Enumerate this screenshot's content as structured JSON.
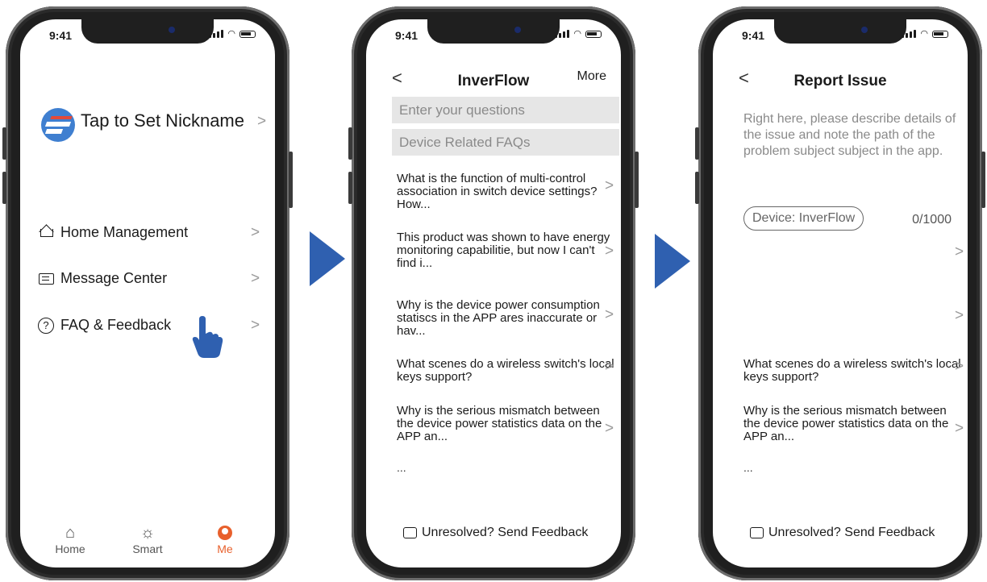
{
  "status": {
    "time": "9:41"
  },
  "screen1": {
    "nickname": "Tap to Set Nickname",
    "menu": [
      {
        "label": "Home Management",
        "icon": "home-icon"
      },
      {
        "label": "Message Center",
        "icon": "message-icon"
      },
      {
        "label": "FAQ & Feedback",
        "icon": "question-icon"
      }
    ],
    "tabs": [
      {
        "label": "Home",
        "icon": "home-icon"
      },
      {
        "label": "Smart",
        "icon": "sun-icon"
      },
      {
        "label": "Me",
        "icon": "user-icon",
        "active": true
      }
    ]
  },
  "screen2": {
    "title": "InverFlow",
    "more": "More",
    "search_placeholder": "Enter your questions",
    "faq_header": "Device Related FAQs",
    "faqs": [
      "What is the function of multi-control association in switch device settings? How...",
      "This product was shown to have energy monitoring capabilitie, but now I can't find i...",
      "Why is the device power consumption statiscs in the APP ares inaccurate or hav...",
      "What scenes do a wireless switch's local keys support?",
      "Why is the serious mismatch between the device power statistics data on the APP an..."
    ],
    "ellipsis": "...",
    "feedback": "Unresolved? Send Feedback"
  },
  "screen3": {
    "title": "Report Issue",
    "description_placeholder": "Right here, please describe details of the issue and note the path of the problem subject subject in the app.",
    "device_tag": "Device: InverFlow",
    "counter": "0/1000",
    "faqs": [
      "What scenes do a wireless switch's local keys support?",
      "Why is the serious mismatch between the device power statistics data on the APP an..."
    ],
    "ellipsis": "...",
    "feedback": "Unresolved? Send Feedback"
  },
  "colors": {
    "accent_orange": "#e8602c",
    "arrow_blue": "#2f60b0",
    "phone_frame": "#1f1f1f"
  }
}
